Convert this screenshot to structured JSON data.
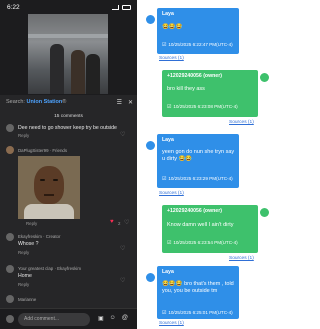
{
  "phone": {
    "status_time": "6:22",
    "search_prefix": "Search: ",
    "search_term": "Union Station",
    "search_suffix": "®",
    "comments_count": "15 comments",
    "comments": [
      {
        "username": "",
        "text": "Dee need to go shower keep try be outside",
        "reply": "Reply",
        "likes": ""
      },
      {
        "username": "DaPlugSister99 · Friends",
        "text": "",
        "reply": "Reply",
        "likes": "2"
      },
      {
        "username": "Ekayfreskim · Creator",
        "text": "Whose ?",
        "reply": "Reply",
        "likes": ""
      },
      {
        "username": "Your greatest clap · Ekayfreskim",
        "text": "Home",
        "reply": "Reply",
        "likes": ""
      },
      {
        "username": "Marianne",
        "text": "",
        "reply": "",
        "likes": ""
      }
    ],
    "add_comment_placeholder": "Add comment..."
  },
  "chat": {
    "colors": {
      "laya": "#2f8fe8",
      "owner": "#3ec16c",
      "link": "#2f6fd6"
    },
    "sources_label": "Sources (1)",
    "messages": [
      {
        "sender": "Laya",
        "role": "laya",
        "text": "😂😂😂",
        "time": "10/25/2025 6:22:47 PM(UTC-4)"
      },
      {
        "sender": "+12029240056 (owner)",
        "role": "owner",
        "text": "bro kill they ass",
        "time": "10/25/2025 6:23:08 PM(UTC-4)"
      },
      {
        "sender": "Laya",
        "role": "laya",
        "text": "yeen gon do nun she tryn say u dirty 😂😂",
        "time": "10/25/2025 6:23:29 PM(UTC-4)"
      },
      {
        "sender": "+12029240056 (owner)",
        "role": "owner",
        "text": "Know damn well I ain't dirty",
        "time": "10/25/2025 6:23:54 PM(UTC-4)"
      },
      {
        "sender": "Laya",
        "role": "laya",
        "text": "😂😂😂 bro that's them , told you, you be outside tm",
        "time": "10/25/2025 6:25:01 PM(UTC-4)"
      }
    ]
  }
}
